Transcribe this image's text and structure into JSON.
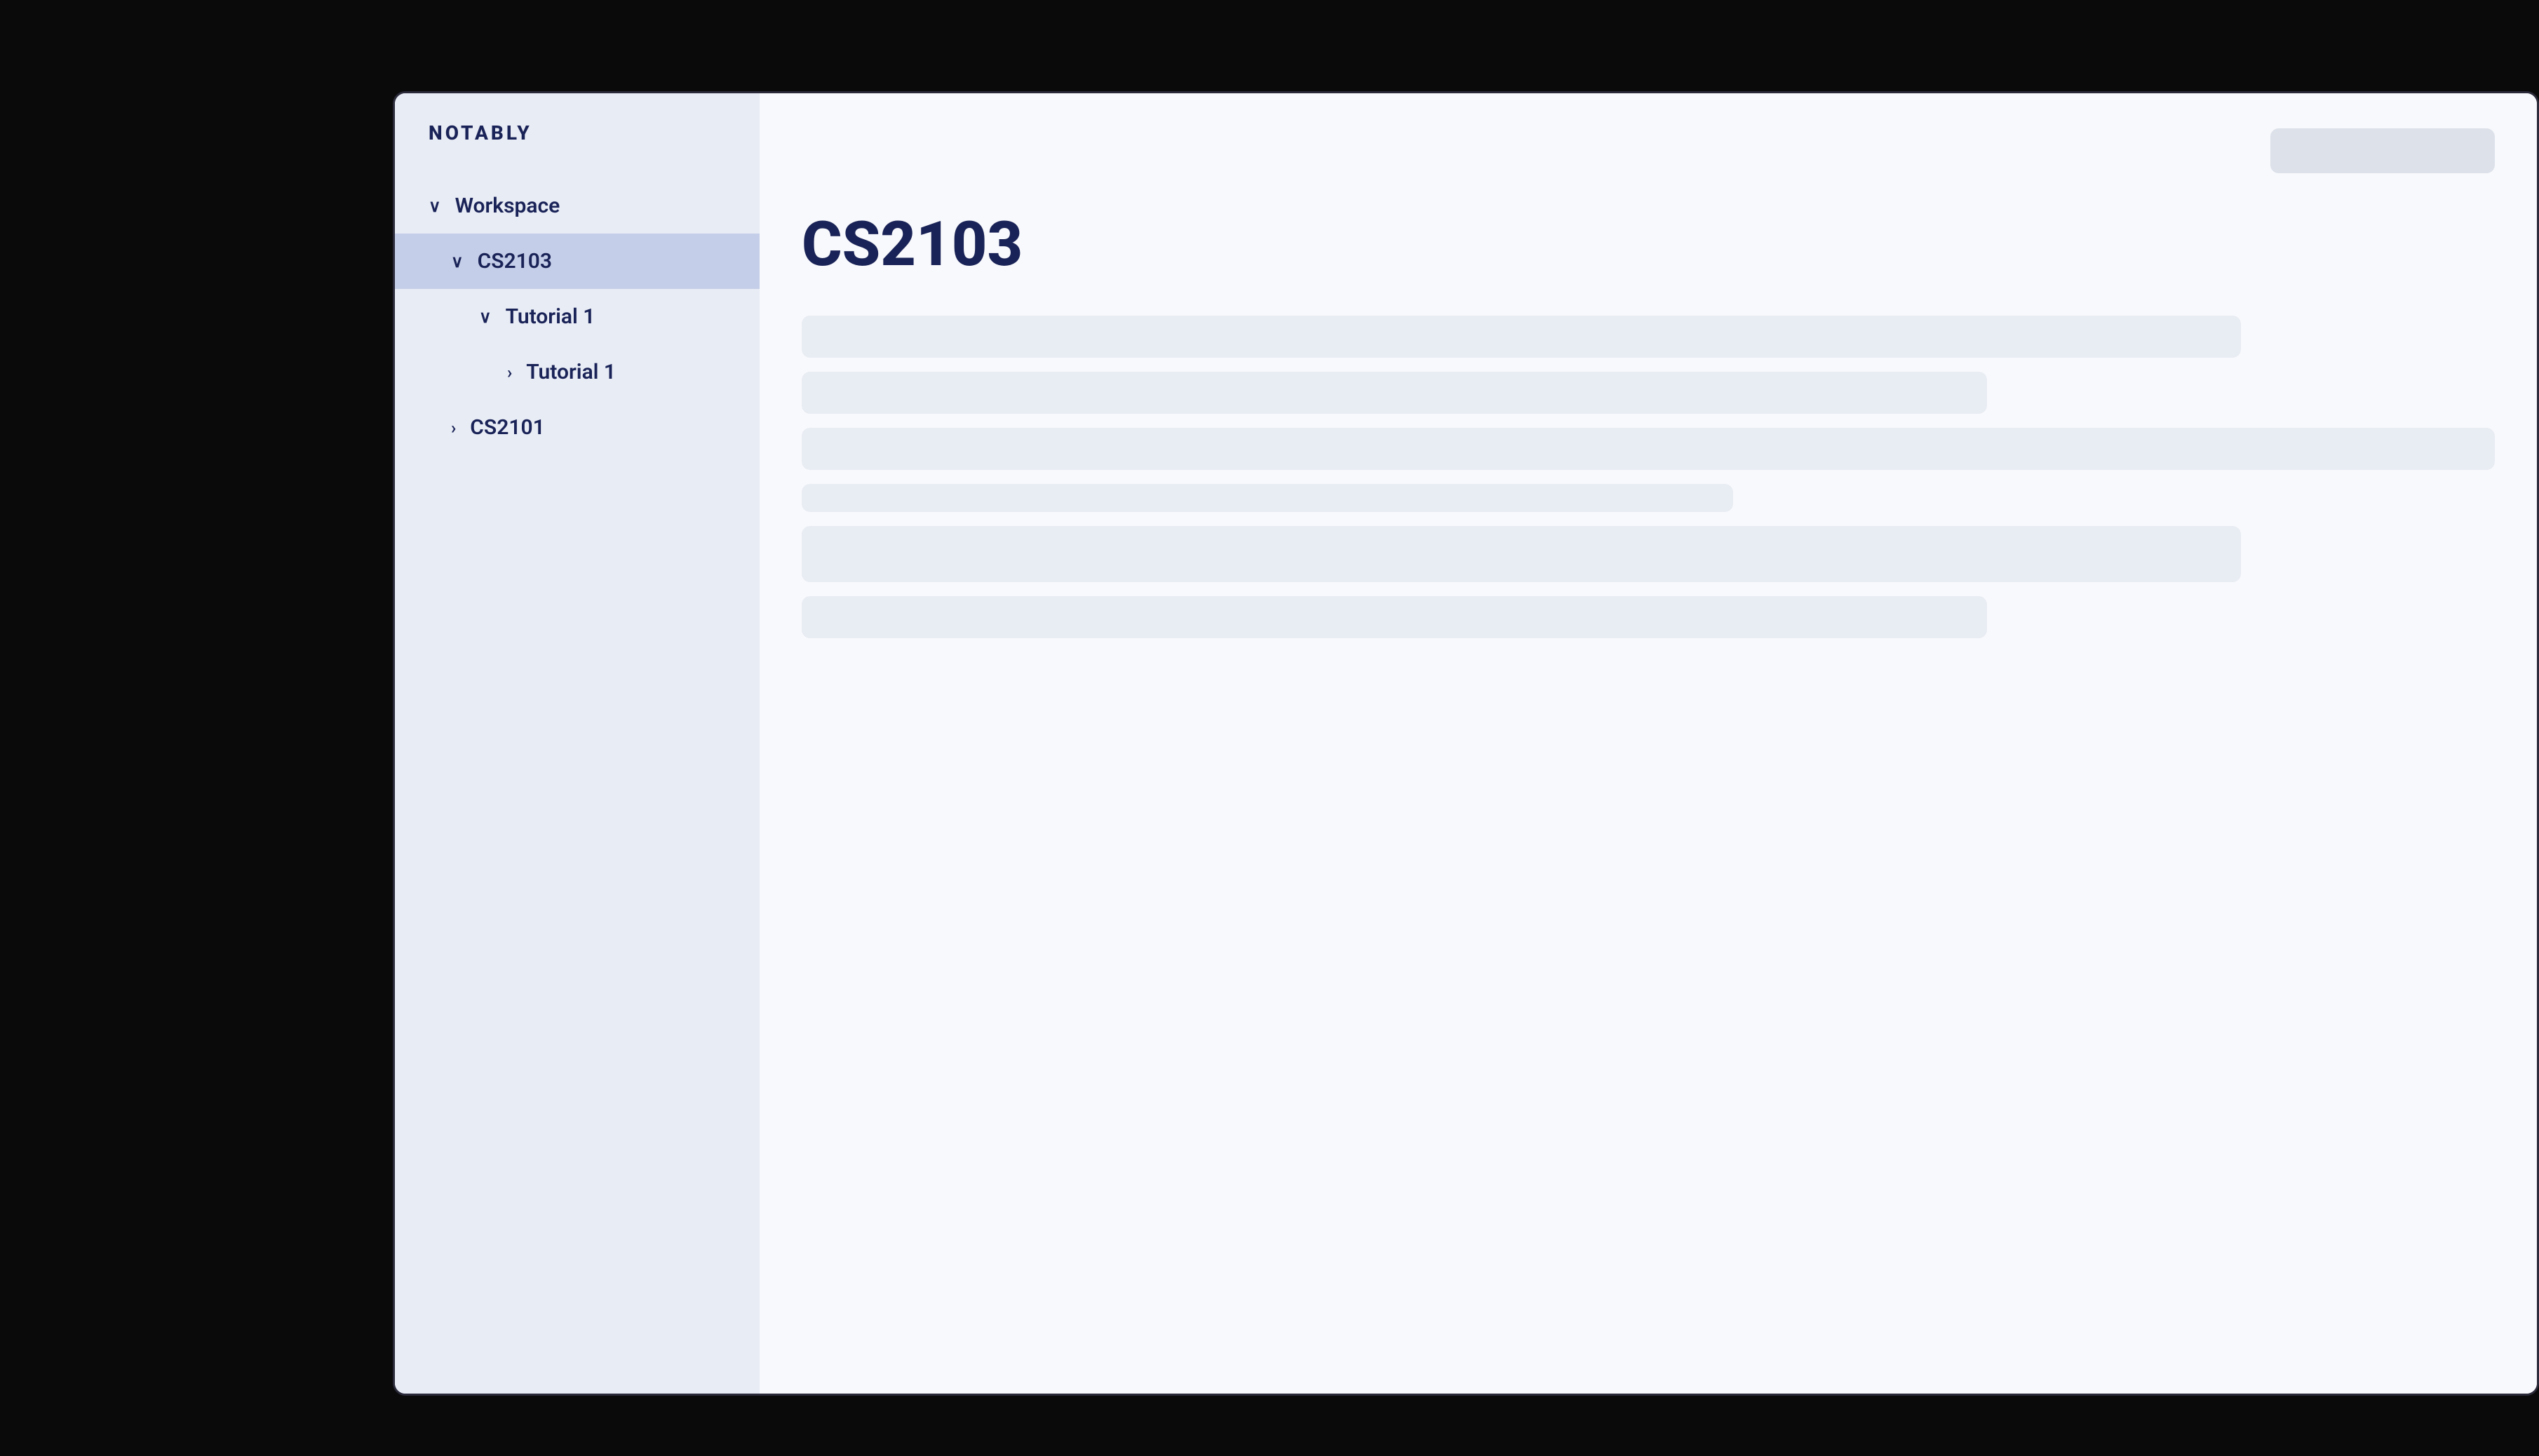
{
  "app": {
    "logo": "NOTABLY"
  },
  "sidebar": {
    "items": [
      {
        "id": "workspace",
        "label": "Workspace",
        "level": 1,
        "chevron": "chevron-down",
        "expanded": true,
        "active": false
      },
      {
        "id": "cs2103",
        "label": "CS2103",
        "level": 2,
        "chevron": "chevron-down",
        "expanded": true,
        "active": true
      },
      {
        "id": "tutorial1-group",
        "label": "Tutorial 1",
        "level": 3,
        "chevron": "chevron-down",
        "expanded": true,
        "active": false
      },
      {
        "id": "tutorial1-item",
        "label": "Tutorial 1",
        "level": 4,
        "chevron": "chevron-right",
        "expanded": false,
        "active": false
      },
      {
        "id": "cs2101",
        "label": "CS2101",
        "level": 2,
        "chevron": "chevron-right",
        "expanded": false,
        "active": false
      }
    ]
  },
  "main": {
    "title": "CS2103",
    "search_placeholder": ""
  },
  "icons": {
    "chevron_down": "∨",
    "chevron_right": "›"
  }
}
